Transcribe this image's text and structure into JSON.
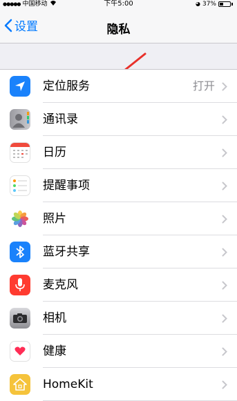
{
  "status_bar": {
    "carrier": "中国移动",
    "time": "下午5:00",
    "battery_percent": "37%",
    "battery_level": 0.37
  },
  "nav": {
    "back_label": "设置",
    "title": "隐私"
  },
  "rows": [
    {
      "label": "定位服务",
      "value": "打开",
      "icon": "location-arrow-icon"
    },
    {
      "label": "通讯录",
      "value": "",
      "icon": "contacts-icon"
    },
    {
      "label": "日历",
      "value": "",
      "icon": "calendar-icon"
    },
    {
      "label": "提醒事项",
      "value": "",
      "icon": "reminders-icon"
    },
    {
      "label": "照片",
      "value": "",
      "icon": "photos-icon"
    },
    {
      "label": "蓝牙共享",
      "value": "",
      "icon": "bluetooth-icon"
    },
    {
      "label": "麦克风",
      "value": "",
      "icon": "microphone-icon"
    },
    {
      "label": "相机",
      "value": "",
      "icon": "camera-icon"
    },
    {
      "label": "健康",
      "value": "",
      "icon": "health-heart-icon"
    },
    {
      "label": "HomeKit",
      "value": "",
      "icon": "homekit-icon"
    }
  ],
  "colors": {
    "accent": "#007aff",
    "annotation_arrow": "#e8302a",
    "background": "#efeff4"
  }
}
